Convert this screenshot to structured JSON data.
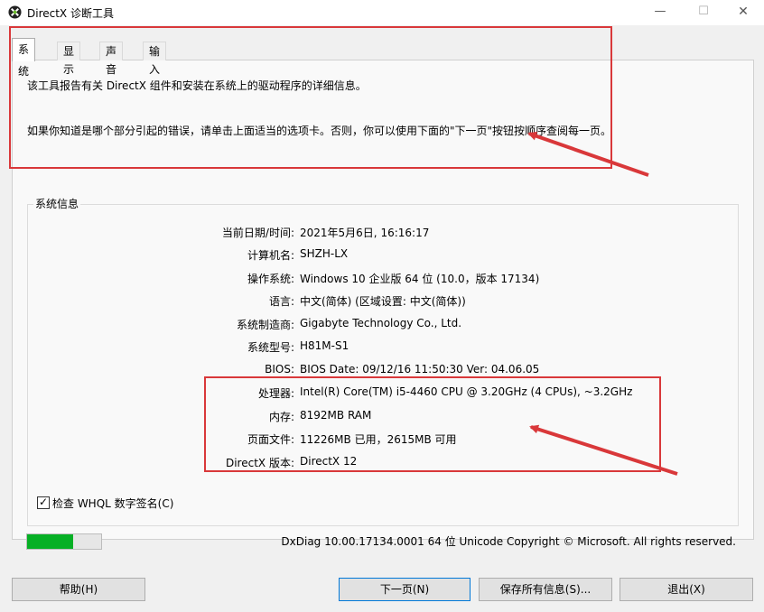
{
  "window": {
    "title": "DirectX 诊断工具",
    "controls": {
      "minimize": "—",
      "maximize": "☐",
      "close": "✕"
    }
  },
  "tabs": [
    {
      "label": "系统",
      "active": true
    },
    {
      "label": "显示",
      "active": false
    },
    {
      "label": "声音",
      "active": false
    },
    {
      "label": "输入",
      "active": false
    }
  ],
  "description": {
    "line1": "该工具报告有关 DirectX 组件和安装在系统上的驱动程序的详细信息。",
    "line2": "如果你知道是哪个部分引起的错误，请单击上面适当的选项卡。否则，你可以使用下面的\"下一页\"按钮按顺序查阅每一页。"
  },
  "system_info": {
    "group_label": "系统信息",
    "rows": [
      {
        "label": "当前日期/时间:",
        "value": "2021年5月6日, 16:16:17"
      },
      {
        "label": "计算机名:",
        "value": "SHZH-LX"
      },
      {
        "label": "操作系统:",
        "value": "Windows 10 企业版 64 位 (10.0，版本 17134)"
      },
      {
        "label": "语言:",
        "value": "中文(简体) (区域设置: 中文(简体))"
      },
      {
        "label": "系统制造商:",
        "value": "Gigabyte Technology Co., Ltd."
      },
      {
        "label": "系统型号:",
        "value": "H81M-S1"
      },
      {
        "label": "BIOS:",
        "value": "BIOS Date: 09/12/16 11:50:30 Ver: 04.06.05"
      },
      {
        "label": "处理器:",
        "value": "Intel(R) Core(TM) i5-4460  CPU @ 3.20GHz (4 CPUs), ~3.2GHz"
      },
      {
        "label": "内存:",
        "value": "8192MB RAM"
      },
      {
        "label": "页面文件:",
        "value": "11226MB 已用，2615MB 可用"
      },
      {
        "label": "DirectX 版本:",
        "value": "DirectX 12"
      }
    ]
  },
  "whql": {
    "label": "检查 WHQL 数字签名(C)",
    "checked": true,
    "mark": "✓"
  },
  "progress": {
    "fraction": 0.62
  },
  "footer": {
    "text": "DxDiag 10.00.17134.0001 64 位 Unicode  Copyright © Microsoft. All rights reserved."
  },
  "buttons": {
    "help": "帮助(H)",
    "next": "下一页(N)",
    "save": "保存所有信息(S)...",
    "exit": "退出(X)"
  },
  "colors": {
    "annotation_red": "#d9383a",
    "progress_green": "#06b025",
    "focus_blue": "#0078d7"
  }
}
